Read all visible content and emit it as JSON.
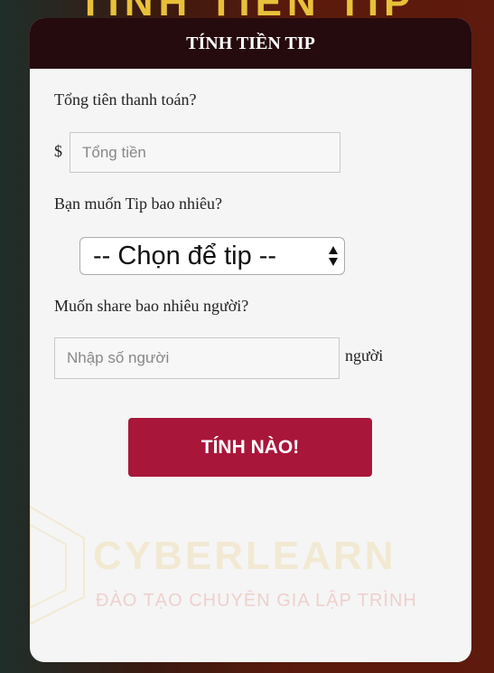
{
  "banner": {
    "title": "TÍNH TIỀN TIP"
  },
  "card": {
    "title": "TÍNH TIỀN TIP"
  },
  "form": {
    "total_label": "Tổng tiên thanh toán?",
    "currency": "$",
    "total_placeholder": "Tổng tiền",
    "tip_label": "Bạn muốn Tip bao nhiêu?",
    "tip_selected": "-- Chọn để tip --",
    "people_label": "Muốn share bao nhiêu người?",
    "people_placeholder": "Nhập số người",
    "people_unit": "người",
    "submit_label": "TÍNH NÀO!"
  },
  "watermark": {
    "brand": "CYBERLEARN",
    "tagline": "ĐÀO TẠO CHUYÊN GIA LẬP TRÌNH"
  },
  "colors": {
    "header_bg": "#250a0e",
    "button_bg": "#a8163a",
    "banner_text": "#e8c13a"
  }
}
